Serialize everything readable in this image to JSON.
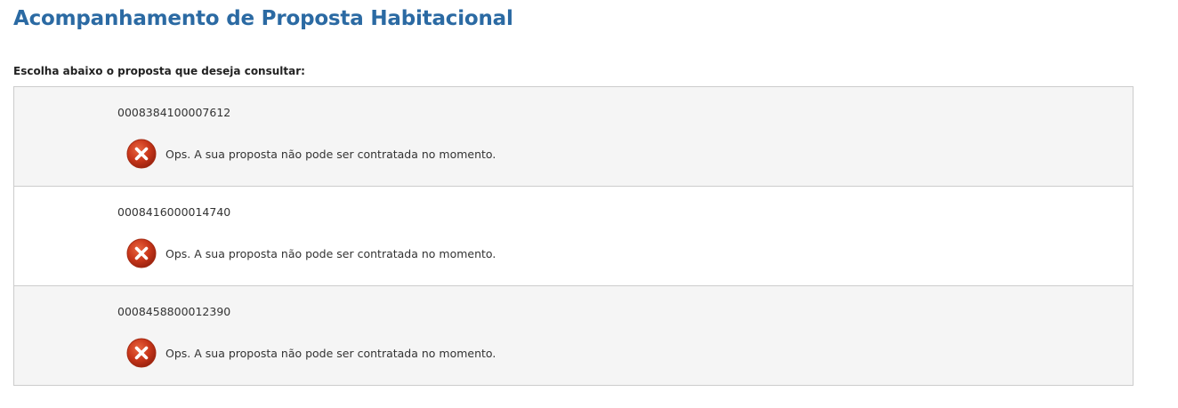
{
  "header": {
    "title": "Acompanhamento de Proposta Habitacional"
  },
  "prompt": {
    "label": "Escolha abaixo o proposta que deseja consultar:"
  },
  "colors": {
    "title": "#2b6aa3",
    "row_shaded": "#f5f5f5",
    "row_plain": "#ffffff",
    "error_icon": "#c8361a"
  },
  "proposals": [
    {
      "number": "0008384100007612",
      "status_icon": "error-x-icon",
      "status_message": "Ops. A sua proposta não pode ser contratada no momento."
    },
    {
      "number": "0008416000014740",
      "status_icon": "error-x-icon",
      "status_message": "Ops. A sua proposta não pode ser contratada no momento."
    },
    {
      "number": "0008458800012390",
      "status_icon": "error-x-icon",
      "status_message": "Ops. A sua proposta não pode ser contratada no momento."
    }
  ]
}
